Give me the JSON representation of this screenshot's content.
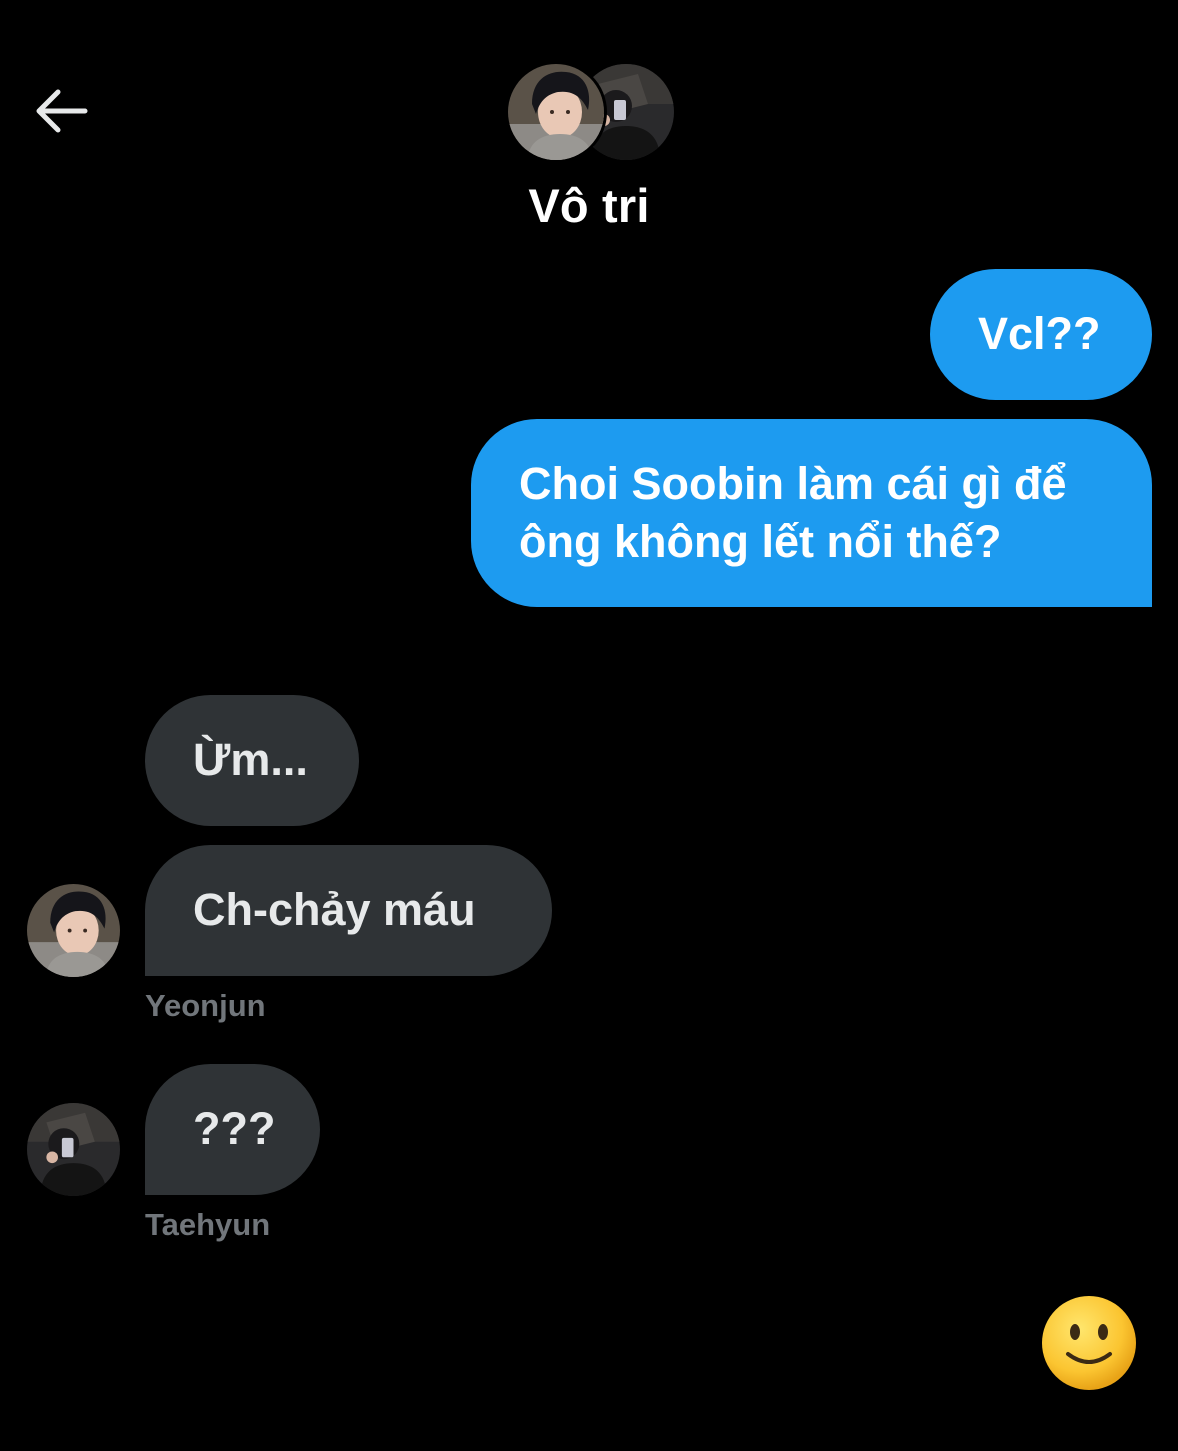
{
  "header": {
    "title": "Vô tri"
  },
  "messages": [
    {
      "direction": "outgoing",
      "text": "Vcl??"
    },
    {
      "direction": "outgoing",
      "text": "Choi Soobin làm cái gì để ông không lết nổi thế?"
    },
    {
      "direction": "incoming",
      "text": "Ừm..."
    },
    {
      "direction": "incoming",
      "text": "Ch-chảy máu",
      "sender": "Yeonjun"
    },
    {
      "direction": "incoming",
      "text": "???",
      "sender": "Taehyun"
    }
  ],
  "icons": {
    "back": "arrow-left-icon",
    "emoji": "slightly-smiling-face-icon"
  },
  "colors": {
    "background": "#000000",
    "outgoing_bubble": "#1d9bf0",
    "incoming_bubble": "#2f3336",
    "sender_name": "#71767b"
  }
}
